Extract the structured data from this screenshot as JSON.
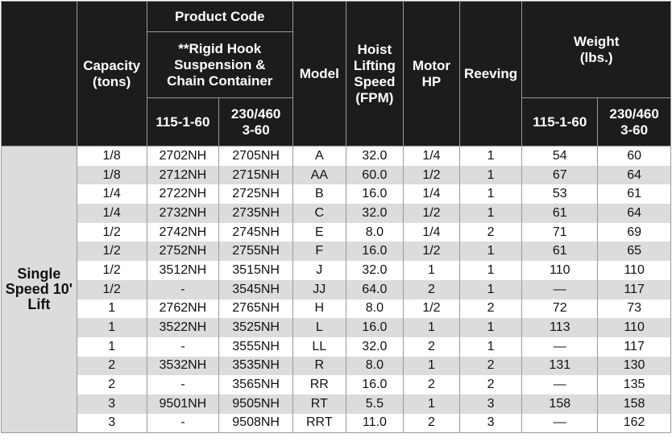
{
  "headers": {
    "product_code": "Product Code",
    "capacity": "Capacity\n(tons)",
    "rigid_hook": "**Rigid Hook\nSuspension &\nChain Container",
    "model": "Model",
    "speed": "Hoist\nLifting\nSpeed\n(FPM)",
    "motor": "Motor\nHP",
    "reeving": "Reeving",
    "weight": "Weight\n(lbs.)",
    "pc_115": "115-1-60",
    "pc_230": "230/460\n3-60",
    "w_115": "115-1-60",
    "w_230": "230/460\n3-60"
  },
  "group_label": "Single\nSpeed\n10' Lift",
  "rows": [
    {
      "capacity": "1/8",
      "pc115": "2702NH",
      "pc230": "2705NH",
      "model": "A",
      "speed": "32.0",
      "hp": "1/4",
      "reeving": "1",
      "w115": "54",
      "w230": "60"
    },
    {
      "capacity": "1/8",
      "pc115": "2712NH",
      "pc230": "2715NH",
      "model": "AA",
      "speed": "60.0",
      "hp": "1/2",
      "reeving": "1",
      "w115": "67",
      "w230": "64"
    },
    {
      "capacity": "1/4",
      "pc115": "2722NH",
      "pc230": "2725NH",
      "model": "B",
      "speed": "16.0",
      "hp": "1/4",
      "reeving": "1",
      "w115": "53",
      "w230": "61"
    },
    {
      "capacity": "1/4",
      "pc115": "2732NH",
      "pc230": "2735NH",
      "model": "C",
      "speed": "32.0",
      "hp": "1/2",
      "reeving": "1",
      "w115": "61",
      "w230": "64"
    },
    {
      "capacity": "1/2",
      "pc115": "2742NH",
      "pc230": "2745NH",
      "model": "E",
      "speed": "8.0",
      "hp": "1/4",
      "reeving": "2",
      "w115": "71",
      "w230": "69"
    },
    {
      "capacity": "1/2",
      "pc115": "2752NH",
      "pc230": "2755NH",
      "model": "F",
      "speed": "16.0",
      "hp": "1/2",
      "reeving": "1",
      "w115": "61",
      "w230": "65"
    },
    {
      "capacity": "1/2",
      "pc115": "3512NH",
      "pc230": "3515NH",
      "model": "J",
      "speed": "32.0",
      "hp": "1",
      "reeving": "1",
      "w115": "110",
      "w230": "110"
    },
    {
      "capacity": "1/2",
      "pc115": "-",
      "pc230": "3545NH",
      "model": "JJ",
      "speed": "64.0",
      "hp": "2",
      "reeving": "1",
      "w115": "—",
      "w230": "117"
    },
    {
      "capacity": "1",
      "pc115": "2762NH",
      "pc230": "2765NH",
      "model": "H",
      "speed": "8.0",
      "hp": "1/2",
      "reeving": "2",
      "w115": "72",
      "w230": "73"
    },
    {
      "capacity": "1",
      "pc115": "3522NH",
      "pc230": "3525NH",
      "model": "L",
      "speed": "16.0",
      "hp": "1",
      "reeving": "1",
      "w115": "113",
      "w230": "110"
    },
    {
      "capacity": "1",
      "pc115": "-",
      "pc230": "3555NH",
      "model": "LL",
      "speed": "32.0",
      "hp": "2",
      "reeving": "1",
      "w115": "—",
      "w230": "117"
    },
    {
      "capacity": "2",
      "pc115": "3532NH",
      "pc230": "3535NH",
      "model": "R",
      "speed": "8.0",
      "hp": "1",
      "reeving": "2",
      "w115": "131",
      "w230": "130"
    },
    {
      "capacity": "2",
      "pc115": "-",
      "pc230": "3565NH",
      "model": "RR",
      "speed": "16.0",
      "hp": "2",
      "reeving": "2",
      "w115": "—",
      "w230": "135"
    },
    {
      "capacity": "3",
      "pc115": "9501NH",
      "pc230": "9505NH",
      "model": "RT",
      "speed": "5.5",
      "hp": "1",
      "reeving": "3",
      "w115": "158",
      "w230": "158"
    },
    {
      "capacity": "3",
      "pc115": "-",
      "pc230": "9508NH",
      "model": "RRT",
      "speed": "11.0",
      "hp": "2",
      "reeving": "3",
      "w115": "—",
      "w230": "162"
    }
  ]
}
